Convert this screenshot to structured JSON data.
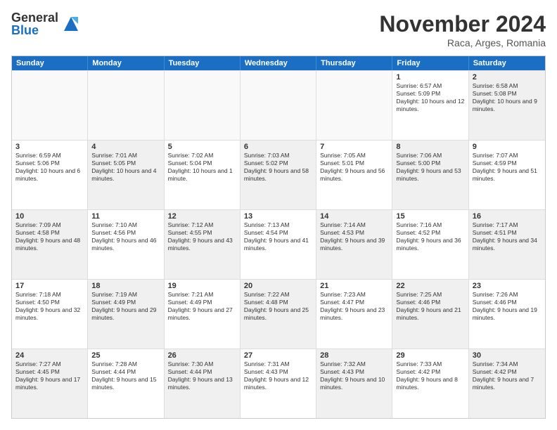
{
  "logo": {
    "general": "General",
    "blue": "Blue"
  },
  "title": "November 2024",
  "location": "Raca, Arges, Romania",
  "weekdays": [
    "Sunday",
    "Monday",
    "Tuesday",
    "Wednesday",
    "Thursday",
    "Friday",
    "Saturday"
  ],
  "rows": [
    [
      {
        "day": "",
        "info": "",
        "empty": true
      },
      {
        "day": "",
        "info": "",
        "empty": true
      },
      {
        "day": "",
        "info": "",
        "empty": true
      },
      {
        "day": "",
        "info": "",
        "empty": true
      },
      {
        "day": "",
        "info": "",
        "empty": true
      },
      {
        "day": "1",
        "info": "Sunrise: 6:57 AM\nSunset: 5:09 PM\nDaylight: 10 hours and 12 minutes."
      },
      {
        "day": "2",
        "info": "Sunrise: 6:58 AM\nSunset: 5:08 PM\nDaylight: 10 hours and 9 minutes.",
        "shaded": true
      }
    ],
    [
      {
        "day": "3",
        "info": "Sunrise: 6:59 AM\nSunset: 5:06 PM\nDaylight: 10 hours and 6 minutes."
      },
      {
        "day": "4",
        "info": "Sunrise: 7:01 AM\nSunset: 5:05 PM\nDaylight: 10 hours and 4 minutes.",
        "shaded": true
      },
      {
        "day": "5",
        "info": "Sunrise: 7:02 AM\nSunset: 5:04 PM\nDaylight: 10 hours and 1 minute."
      },
      {
        "day": "6",
        "info": "Sunrise: 7:03 AM\nSunset: 5:02 PM\nDaylight: 9 hours and 58 minutes.",
        "shaded": true
      },
      {
        "day": "7",
        "info": "Sunrise: 7:05 AM\nSunset: 5:01 PM\nDaylight: 9 hours and 56 minutes."
      },
      {
        "day": "8",
        "info": "Sunrise: 7:06 AM\nSunset: 5:00 PM\nDaylight: 9 hours and 53 minutes.",
        "shaded": true
      },
      {
        "day": "9",
        "info": "Sunrise: 7:07 AM\nSunset: 4:59 PM\nDaylight: 9 hours and 51 minutes."
      }
    ],
    [
      {
        "day": "10",
        "info": "Sunrise: 7:09 AM\nSunset: 4:58 PM\nDaylight: 9 hours and 48 minutes.",
        "shaded": true
      },
      {
        "day": "11",
        "info": "Sunrise: 7:10 AM\nSunset: 4:56 PM\nDaylight: 9 hours and 46 minutes."
      },
      {
        "day": "12",
        "info": "Sunrise: 7:12 AM\nSunset: 4:55 PM\nDaylight: 9 hours and 43 minutes.",
        "shaded": true
      },
      {
        "day": "13",
        "info": "Sunrise: 7:13 AM\nSunset: 4:54 PM\nDaylight: 9 hours and 41 minutes."
      },
      {
        "day": "14",
        "info": "Sunrise: 7:14 AM\nSunset: 4:53 PM\nDaylight: 9 hours and 39 minutes.",
        "shaded": true
      },
      {
        "day": "15",
        "info": "Sunrise: 7:16 AM\nSunset: 4:52 PM\nDaylight: 9 hours and 36 minutes."
      },
      {
        "day": "16",
        "info": "Sunrise: 7:17 AM\nSunset: 4:51 PM\nDaylight: 9 hours and 34 minutes.",
        "shaded": true
      }
    ],
    [
      {
        "day": "17",
        "info": "Sunrise: 7:18 AM\nSunset: 4:50 PM\nDaylight: 9 hours and 32 minutes."
      },
      {
        "day": "18",
        "info": "Sunrise: 7:19 AM\nSunset: 4:49 PM\nDaylight: 9 hours and 29 minutes.",
        "shaded": true
      },
      {
        "day": "19",
        "info": "Sunrise: 7:21 AM\nSunset: 4:49 PM\nDaylight: 9 hours and 27 minutes."
      },
      {
        "day": "20",
        "info": "Sunrise: 7:22 AM\nSunset: 4:48 PM\nDaylight: 9 hours and 25 minutes.",
        "shaded": true
      },
      {
        "day": "21",
        "info": "Sunrise: 7:23 AM\nSunset: 4:47 PM\nDaylight: 9 hours and 23 minutes."
      },
      {
        "day": "22",
        "info": "Sunrise: 7:25 AM\nSunset: 4:46 PM\nDaylight: 9 hours and 21 minutes.",
        "shaded": true
      },
      {
        "day": "23",
        "info": "Sunrise: 7:26 AM\nSunset: 4:46 PM\nDaylight: 9 hours and 19 minutes."
      }
    ],
    [
      {
        "day": "24",
        "info": "Sunrise: 7:27 AM\nSunset: 4:45 PM\nDaylight: 9 hours and 17 minutes.",
        "shaded": true
      },
      {
        "day": "25",
        "info": "Sunrise: 7:28 AM\nSunset: 4:44 PM\nDaylight: 9 hours and 15 minutes."
      },
      {
        "day": "26",
        "info": "Sunrise: 7:30 AM\nSunset: 4:44 PM\nDaylight: 9 hours and 13 minutes.",
        "shaded": true
      },
      {
        "day": "27",
        "info": "Sunrise: 7:31 AM\nSunset: 4:43 PM\nDaylight: 9 hours and 12 minutes."
      },
      {
        "day": "28",
        "info": "Sunrise: 7:32 AM\nSunset: 4:43 PM\nDaylight: 9 hours and 10 minutes.",
        "shaded": true
      },
      {
        "day": "29",
        "info": "Sunrise: 7:33 AM\nSunset: 4:42 PM\nDaylight: 9 hours and 8 minutes."
      },
      {
        "day": "30",
        "info": "Sunrise: 7:34 AM\nSunset: 4:42 PM\nDaylight: 9 hours and 7 minutes.",
        "shaded": true
      }
    ]
  ]
}
